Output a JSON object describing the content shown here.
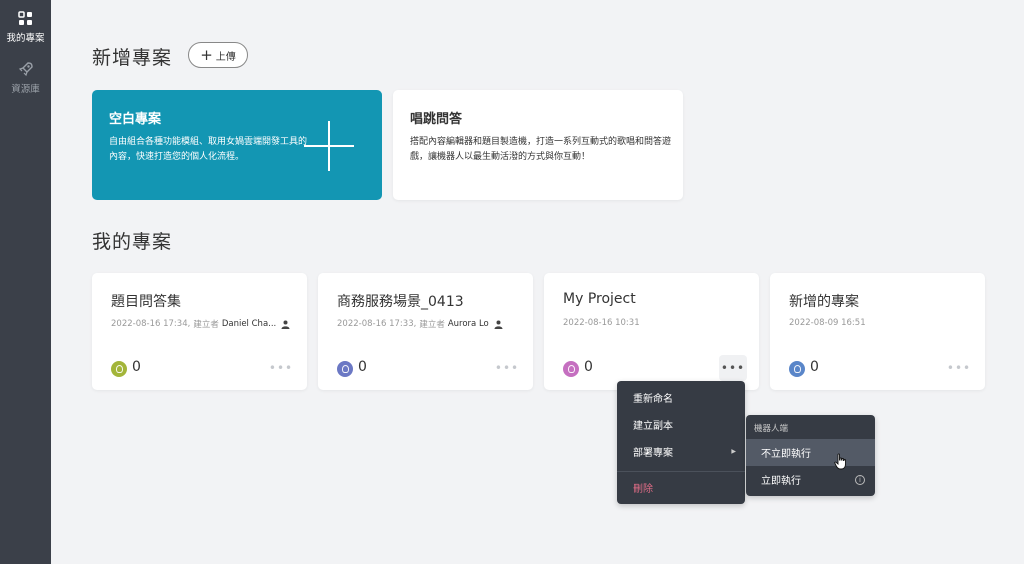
{
  "sidebar": {
    "items": [
      {
        "label": "我的專案",
        "icon": "grid-icon"
      },
      {
        "label": "資源庫",
        "icon": "rocket-icon"
      }
    ]
  },
  "new_project": {
    "title": "新增專案",
    "upload_label": "上傳"
  },
  "templates": [
    {
      "title": "空白專案",
      "desc": "自由組合各種功能模組、取用女媧雲端開發工具的內容，快速打造您的個人化流程。"
    },
    {
      "title": "唱跳問答",
      "desc": "搭配內容編輯器和題目製造機，打造一系列互動式的歌唱和問答遊戲，讓機器人以最生動活潑的方式與你互動！"
    }
  ],
  "my_projects": {
    "title": "我的專案",
    "items": [
      {
        "name": "題目問答集",
        "date": "2022-08-16 17:34,",
        "creator_label": "建立者",
        "creator": "Daniel Cha...",
        "count": "0",
        "avatar_color": "#a3b53a"
      },
      {
        "name": "商務服務場景_0413",
        "date": "2022-08-16 17:33,",
        "creator_label": "建立者",
        "creator": "Aurora Lo",
        "count": "0",
        "avatar_color": "#6b78c4"
      },
      {
        "name": "My Project",
        "date": "2022-08-16 10:31",
        "creator_label": "",
        "creator": "",
        "count": "0",
        "avatar_color": "#c56fc0"
      },
      {
        "name": "新增的專案",
        "date": "2022-08-09 16:51",
        "creator_label": "",
        "creator": "",
        "count": "0",
        "avatar_color": "#5a86c9"
      }
    ]
  },
  "context_menu": {
    "rename": "重新命名",
    "duplicate": "建立副本",
    "deploy": "部署專案",
    "delete": "刪除"
  },
  "deploy_submenu": {
    "header": "機器人端",
    "no_run": "不立即執行",
    "run_now": "立即執行"
  },
  "colors": {
    "sidebar_bg": "#3b4049",
    "accent": "#1396b3",
    "danger": "#e06d87"
  }
}
